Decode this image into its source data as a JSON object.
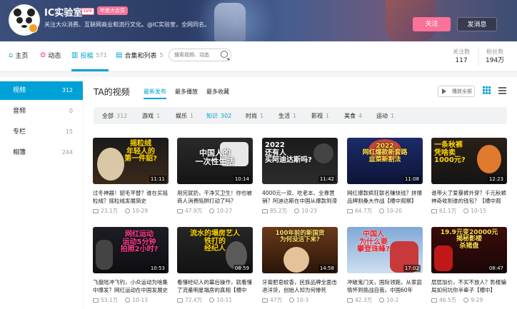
{
  "profile": {
    "name": "IC实验室",
    "level": "LV6",
    "vip": "年度大会员",
    "sign": "关注大众消费、互联网商业和流行文化。@IC实验室，全网同名。",
    "follow_label": "关注",
    "message_label": "发消息"
  },
  "nav": {
    "home": "主页",
    "dynamic": "动态",
    "posts": "投稿",
    "posts_count": "571",
    "collections": "合集和列表",
    "collections_count": "5",
    "search_placeholder": "搜索视频、动态",
    "following_label": "关注数",
    "following_value": "117",
    "fans_label": "粉丝数",
    "fans_value": "194万"
  },
  "sidebar": {
    "items": [
      {
        "label": "视频",
        "count": "312"
      },
      {
        "label": "音频",
        "count": "0"
      },
      {
        "label": "专栏",
        "count": "15"
      },
      {
        "label": "相簿",
        "count": "244"
      }
    ]
  },
  "main": {
    "title": "TA的视频",
    "sorts": [
      "最新发布",
      "最多播放",
      "最多收藏"
    ],
    "play_all": "播放全部",
    "filters": [
      {
        "label": "全部",
        "count": "312"
      },
      {
        "label": "游戏",
        "count": "1"
      },
      {
        "label": "娱乐",
        "count": "1"
      },
      {
        "label": "知识",
        "count": "302"
      },
      {
        "label": "时尚",
        "count": "1"
      },
      {
        "label": "生活",
        "count": "1"
      },
      {
        "label": "影视",
        "count": "1"
      },
      {
        "label": "美食",
        "count": "4"
      },
      {
        "label": "运动",
        "count": "1"
      }
    ]
  },
  "videos": [
    {
      "caption": "摇粒绒\n年轻人的\n第一件貂?",
      "duration": "11:11",
      "title": "过冬神器！貂毛平替？谁在买摇粒绒？摇粒绒发展简史",
      "views": "23.1万",
      "date": "10-29"
    },
    {
      "caption": "中国人的\n一次性生活",
      "duration": "10:14",
      "title": "用完就扔，干净又卫生！你也被商人消费陷阱打动了吗？",
      "views": "47.9万",
      "date": "10-27"
    },
    {
      "caption": "2022\n还有人\n买阿迪达斯吗?",
      "duration": "11:42",
      "title": "4000元一双、吃老本、全靠营销？阿迪达斯在中国从爆款到滞销",
      "views": "85.2万",
      "date": "10-23"
    },
    {
      "caption": "2022\n网红爆款新套路\n韭菜新割法",
      "duration": "11:08",
      "title": "网红爆款疯狂联名赚快钱？拼爆品牌割桑大作战【槽中观察】",
      "views": "64.7万",
      "date": "10-20"
    },
    {
      "caption": "一条秋裤\n凭啥卖\n1000元?",
      "duration": "12:23",
      "title": "谁带火了爱暴裤外穿？千元秋裤神奇收割谁的钱包？【槽中观察】",
      "views": "61.1万",
      "date": "10-15"
    },
    {
      "caption": "网红运动\n运动5分钟\n拍照2小时?",
      "duration": "10:53",
      "title": "飞盘陆冲飞钓，小众运动为啥集中爆发？网红运动在中国发展史",
      "views": "53.1万",
      "date": "10-13"
    },
    {
      "caption": "流水的塌房艺人\n铁打的\n经纪人",
      "duration": "08:59",
      "title": "看懂经纪人的幕后操作，就看懂了流量明星塌房的真相【槽中",
      "views": "72.4万",
      "date": "10-11"
    },
    {
      "caption": "100年前的新国货\n为何没活下来?",
      "duration": "14:58",
      "title": "牙膏肥皂蚊香，民族品牌全面击退洋货，创始人却为何惨死",
      "views": "47万",
      "date": "10-3"
    },
    {
      "caption": "中国人\n为什么要\n攀登珠峰?",
      "duration": "17:02",
      "title": "冲破鬼门关，国际领跑，从家庭情怀到挑战自我，中国60年",
      "views": "42.3万",
      "date": "10-2"
    },
    {
      "caption": "19.9元变20000元\n揭秘影楼\n杀猪盘",
      "duration": "08:47",
      "title": "层层加价，不买不放人？影楼骗局如何坑你半辈子【槽中】",
      "views": "46.5万",
      "date": "9-29"
    }
  ]
}
